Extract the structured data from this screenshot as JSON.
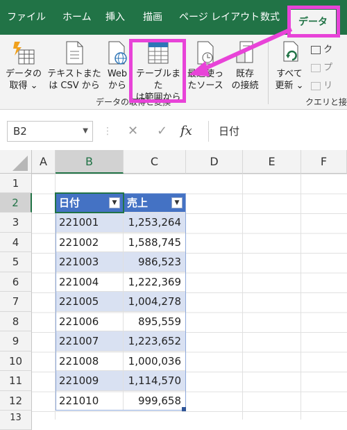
{
  "tabs": [
    "ファイル",
    "ホーム",
    "挿入",
    "描画",
    "ページ レイアウト",
    "数式",
    "データ"
  ],
  "ribbon": {
    "buttons": [
      {
        "line1": "データの",
        "line2": "取得 ⌄"
      },
      {
        "line1": "テキストまた",
        "line2": "は CSV から"
      },
      {
        "line1": "Web",
        "line2": "から"
      },
      {
        "line1": "テーブルまた",
        "line2": "は範囲から"
      },
      {
        "line1": "最近使っ",
        "line2": "たソース"
      },
      {
        "line1": "既存",
        "line2": "の接続"
      },
      {
        "line1": "すべて",
        "line2": "更新 ⌄"
      }
    ],
    "group_get": "データの取得と変換",
    "group_query": "クエリと接",
    "small_items": [
      "ク",
      "プ",
      "リ"
    ]
  },
  "formula_bar": {
    "name_box": "B2",
    "cancel_symbol": "✕",
    "enter_symbol": "✓",
    "fx_symbol": "fx",
    "value": "日付"
  },
  "grid": {
    "columns": [
      "A",
      "B",
      "C",
      "D",
      "E",
      "F"
    ],
    "rows": [
      "1",
      "2",
      "3",
      "4",
      "5",
      "6",
      "7",
      "8",
      "9",
      "10",
      "11",
      "12",
      "13"
    ],
    "table_headers": [
      "日付",
      "売上"
    ],
    "table_rows": [
      [
        "221001",
        "1,253,264"
      ],
      [
        "221002",
        "1,588,745"
      ],
      [
        "221003",
        "986,523"
      ],
      [
        "221004",
        "1,222,369"
      ],
      [
        "221005",
        "1,004,278"
      ],
      [
        "221006",
        "895,559"
      ],
      [
        "221007",
        "1,223,652"
      ],
      [
        "221008",
        "1,000,036"
      ],
      [
        "221009",
        "1,114,570"
      ],
      [
        "221010",
        "999,658"
      ]
    ]
  },
  "colors": {
    "excel_green": "#217346",
    "table_header": "#4472c4",
    "table_band": "#d9e1f2",
    "highlight": "#e843d8"
  }
}
